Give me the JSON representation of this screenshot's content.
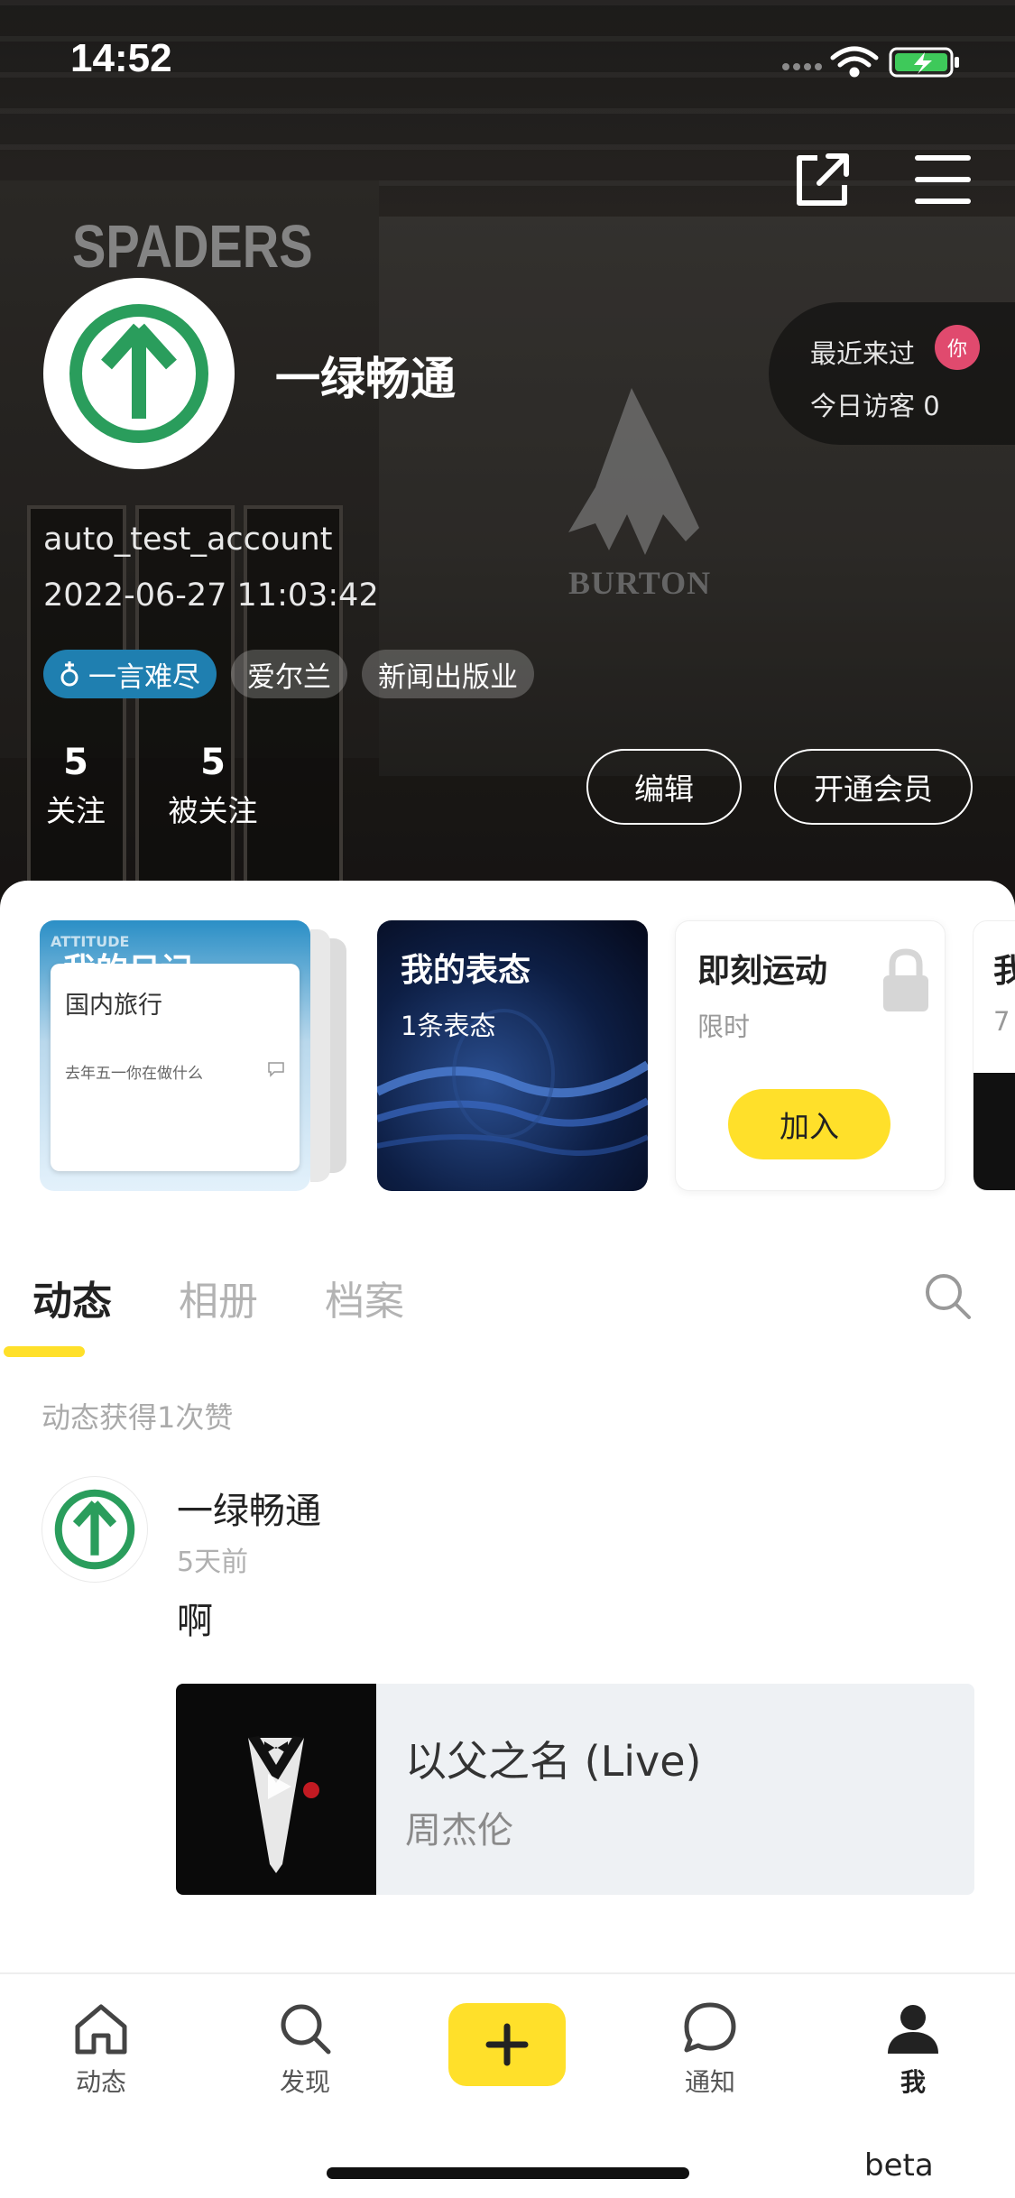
{
  "status_bar": {
    "time": "14:52"
  },
  "header": {
    "background_sign": "SPADERS",
    "background_brand": "BURTON",
    "nickname": "一绿畅通",
    "username": "auto_test_account",
    "join_date": "2022-06-27 11:03:42",
    "visitors": {
      "recent_label": "最近来过",
      "recent_avatar_text": "你",
      "today_label": "今日访客 0"
    },
    "tags": [
      {
        "label": "一言难尽",
        "icon": "female-gender-icon"
      },
      {
        "label": "爱尔兰"
      },
      {
        "label": "新闻出版业"
      }
    ],
    "stats": {
      "following": {
        "count": "5",
        "label": "关注"
      },
      "followers": {
        "count": "5",
        "label": "被关注"
      }
    },
    "buttons": {
      "edit": "编辑",
      "vip": "开通会员"
    }
  },
  "cards": {
    "diary": {
      "tag": "ATTITUDE",
      "title": "我的日记",
      "subtitle": "国内旅行",
      "entry": "去年五一你在做什么"
    },
    "mood": {
      "title": "我的表态",
      "subtitle": "1条表态"
    },
    "sport": {
      "title": "即刻运动",
      "subtitle": "限时",
      "button": "加入"
    },
    "partial": {
      "title": "我",
      "subtitle": "7"
    }
  },
  "tabs": [
    {
      "label": "动态",
      "active": true
    },
    {
      "label": "相册",
      "active": false
    },
    {
      "label": "档案",
      "active": false
    }
  ],
  "likes_summary": "动态获得1次赞",
  "post": {
    "author": "一绿畅通",
    "time": "5天前",
    "text": "啊",
    "music": {
      "title": "以父之名 (Live)",
      "artist": "周杰伦"
    }
  },
  "nav": {
    "items": [
      {
        "label": "动态",
        "icon": "home-icon"
      },
      {
        "label": "发现",
        "icon": "search-icon"
      },
      {
        "label": "",
        "icon": "plus-icon"
      },
      {
        "label": "通知",
        "icon": "chat-bubble-icon"
      },
      {
        "label": "我",
        "icon": "user-icon",
        "active": true
      }
    ],
    "beta": "beta"
  },
  "colors": {
    "accent_yellow": "#ffe02a",
    "brand_green": "#2a9d5c",
    "gender_blue": "#1f7fb0",
    "visitor_pink": "#e04a6e"
  }
}
